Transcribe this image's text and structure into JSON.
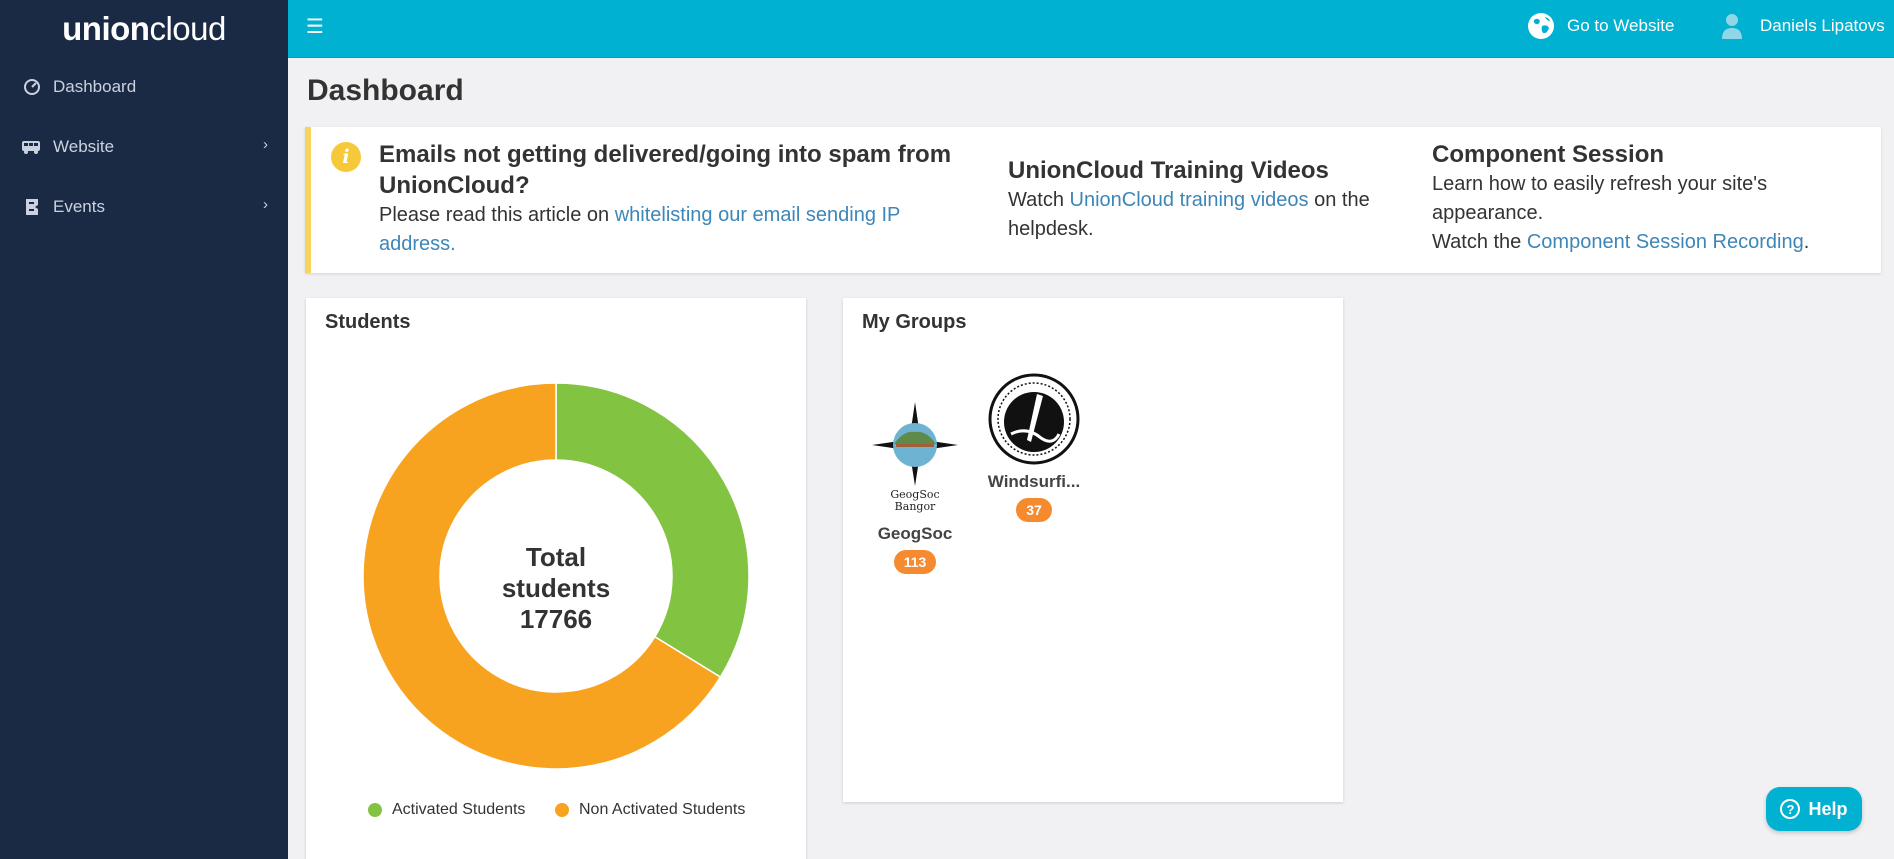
{
  "brand": {
    "name_bold": "union",
    "name_light": "cloud"
  },
  "sidebar": {
    "items": [
      {
        "label": "Dashboard",
        "icon": "dashboard-gauge-icon"
      },
      {
        "label": "Website",
        "icon": "website-bus-icon",
        "chevron": "›"
      },
      {
        "label": "Events",
        "icon": "events-ticket-icon",
        "chevron": "›"
      }
    ]
  },
  "topbar": {
    "menu_icon": "☰",
    "go_to_website": "Go to Website",
    "user_name": "Daniels Lipatovs"
  },
  "page": {
    "title": "Dashboard"
  },
  "notice": {
    "col1": {
      "title": "Emails not getting delivered/going into spam from UnionCloud?",
      "text_before": "Please read this article on ",
      "link": "whitelisting our email sending IP address."
    },
    "col2": {
      "title": "UnionCloud Training Videos",
      "text_before": "Watch ",
      "link": "UnionCloud training videos",
      "text_after": " on the helpdesk."
    },
    "col3": {
      "title": "Component Session",
      "text1": "Learn how to easily refresh your site's appearance.",
      "text_before": "Watch the ",
      "link": "Component Session Recording",
      "text_after": "."
    }
  },
  "students_card": {
    "title": "Students",
    "center_line1": "Total",
    "center_line2": "students",
    "center_line3": "17766"
  },
  "chart_data": {
    "type": "pie",
    "title": "",
    "categories": [
      "Activated Students",
      "Non Activated Students"
    ],
    "values": [
      6000,
      11766
    ],
    "colors": [
      "#82c341",
      "#f7a31f"
    ],
    "total": 17766,
    "donut": true,
    "legend": "bottom"
  },
  "groups_card": {
    "title": "My Groups",
    "groups": [
      {
        "name": "GeogSoc",
        "count": "113",
        "logo_text_1": "GeogSoc",
        "logo_text_2": "Bangor"
      },
      {
        "name": "Windsurfi...",
        "count": "37"
      }
    ]
  },
  "help": {
    "label": "Help"
  },
  "colors": {
    "sidebar": "#1b2a44",
    "topbar": "#00b1d2",
    "accent_link": "#3d86b8",
    "badge": "#f58a2f",
    "notice_border": "#f6d55c"
  }
}
